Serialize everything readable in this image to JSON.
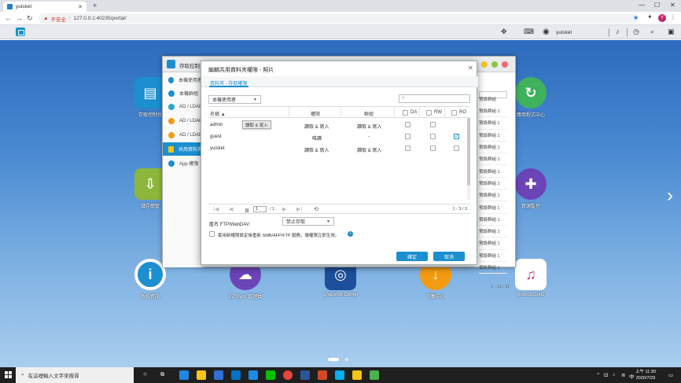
{
  "browser": {
    "tab_title": "yuisket",
    "insecure_label": "不安全",
    "url": "127.0.0.1:40235/portal/"
  },
  "qts": {
    "user": "yuisket"
  },
  "desktop_apps": [
    {
      "name": "存取控制台",
      "color": "#1b8fd0"
    },
    {
      "name": "應用程式中心",
      "color": "#3fb25d"
    },
    {
      "name": "儲存總管",
      "color": "#8cb63c"
    },
    {
      "name": "資源監控",
      "color": "#6b44b8"
    },
    {
      "name": "系統資訊",
      "color": "#1b8fd0"
    },
    {
      "name": "EZ Sync 管理員",
      "color": "#6b44b8"
    },
    {
      "name": "Snapshot Center",
      "color": "#1d4f9a"
    },
    {
      "name": "下載中心",
      "color": "#f39c12"
    },
    {
      "name": "SoundsGood",
      "color": "#ffffff"
    }
  ],
  "back_window": {
    "title": "存取控制台",
    "side_items": [
      "本機使用者",
      "本機群組",
      "AD / LDAP",
      "AD / LDAP",
      "AD / LDAP",
      "共用資料夾",
      "App 權限"
    ],
    "right_rows": [
      "預設群組 1",
      "預設群組 1",
      "預設群組 1",
      "預設群組 1",
      "預設群組 1",
      "預設群組 1",
      "預設群組 1",
      "預設群組 1",
      "預設群組 1",
      "預設群組 1",
      "預設群組 1",
      "預設群組 1",
      "預設群組 1",
      "預設群組 1",
      "預設群組 1"
    ],
    "right_header": "預設群組",
    "right_footer": "1 - 11 / 11"
  },
  "modal": {
    "title": "編輯共用資料夾權限 - 照片",
    "tab": "資料夾 - 存取權限",
    "user_type": "本機使用者",
    "columns": {
      "name": "名稱",
      "permission": "權限",
      "group": "群組",
      "da": "DA",
      "rw": "RW",
      "ro": "RO"
    },
    "rows": [
      {
        "name": "admin",
        "permission": "讀取 & 寫入",
        "group": "讀取 & 寫入",
        "da": false,
        "rw": false,
        "ro": false
      },
      {
        "name": "guest",
        "permission": "唯讀",
        "group": "-",
        "da": false,
        "rw": false,
        "ro": true
      },
      {
        "name": "yuisket",
        "permission": "讀取 & 寫入",
        "group": "讀取 & 寫入",
        "da": false,
        "rw": false,
        "ro": false
      }
    ],
    "tooltip": "讀取 & 寫入",
    "page_current": "1",
    "page_total": "/ 1",
    "page_range": "1 - 3 / 3",
    "guest_label": "匿名 FTP/WebDAV:",
    "guest_value": "禁止存取",
    "apply_label": "套用新權限設定後重新 SMB/AFP/FTP 服務，讓權限立即生效。",
    "ok_label": "確定",
    "cancel_label": "取消"
  },
  "taskbar": {
    "search_placeholder": "在這裡輸入文字來搜尋",
    "ime": "中",
    "time": "上午 11:30",
    "date": "2020/7/29"
  }
}
